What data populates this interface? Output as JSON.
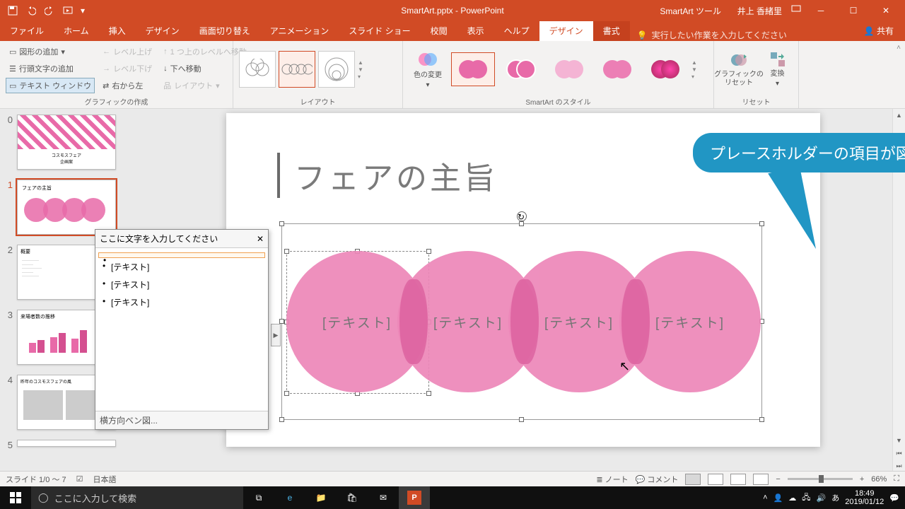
{
  "title": {
    "file": "SmartArt.pptx  -  PowerPoint",
    "tool": "SmartArt ツール",
    "user": "井上 香緒里"
  },
  "tabs": {
    "file": "ファイル",
    "home": "ホーム",
    "insert": "挿入",
    "design": "デザイン",
    "trans": "画面切り替え",
    "anim": "アニメーション",
    "show": "スライド ショー",
    "review": "校閲",
    "view": "表示",
    "help": "ヘルプ",
    "ctx_design": "デザイン",
    "ctx_format": "書式",
    "tellme": "実行したい作業を入力してください",
    "share": "共有"
  },
  "ribbon": {
    "create": {
      "addshape": "図形の追加",
      "addbullet": "行頭文字の追加",
      "textpane": "テキスト ウィンドウ",
      "levelup": "レベル上げ",
      "leveldown": "レベル下げ",
      "rtl": "右から左",
      "moveup": "1 つ上のレベルへ移動",
      "movedown": "下へ移動",
      "layoutbtn": "レイアウト",
      "label": "グラフィックの作成"
    },
    "layout": {
      "label": "レイアウト"
    },
    "colors": {
      "btn": "色の変更"
    },
    "styles": {
      "label": "SmartArt のスタイル"
    },
    "reset": {
      "reset": "グラフィックの\nリセット",
      "convert": "変換",
      "label": "リセット"
    }
  },
  "slide": {
    "title": "フェアの主旨",
    "placeholder": "[テキスト]"
  },
  "callout": "プレースホルダーの項目が図表に変わった",
  "textpane": {
    "header": "ここに文字を入力してください",
    "items": [
      "",
      "[テキスト]",
      "[テキスト]",
      "[テキスト]"
    ],
    "footer": "横方向ベン図..."
  },
  "thumbs": {
    "t0": "コスモスフェア\n企画案",
    "t1": "フェアの主旨",
    "t2": "概要",
    "t3": "来場者数の推移",
    "t4": "昨年のコスモスフェアの風"
  },
  "status": {
    "slide": "スライド 1/0 ～ 7",
    "lang": "日本語",
    "notes": "ノート",
    "comments": "コメント",
    "zoom": "66%"
  },
  "taskbar": {
    "search": "ここに入力して検索",
    "time": "18:49",
    "date": "2019/01/12"
  }
}
